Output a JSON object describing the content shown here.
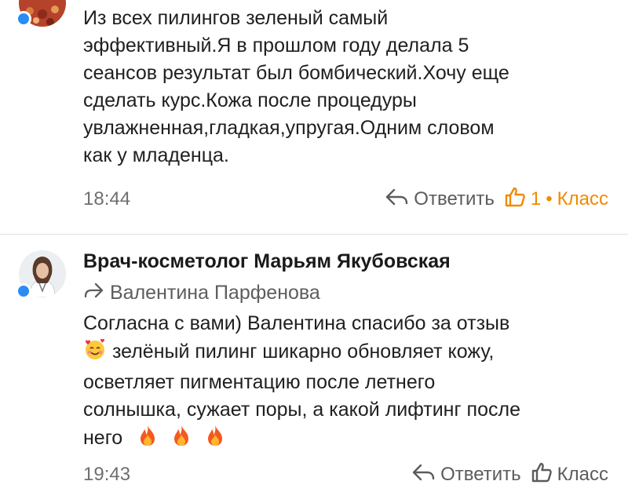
{
  "comments": [
    {
      "text_lines": [
        "Из всех пилингов зеленый самый",
        "эффективный.Я в прошлом году делала 5",
        "сеансов результат был бомбический.Хочу еще",
        "сделать курс.Кожа после процедуры",
        "увлажненная,гладкая,упругая.Одним словом",
        "как у младенца."
      ],
      "time": "18:44",
      "reply_label": "Ответить",
      "like_count": "1",
      "separator": "•",
      "klass_label": "Класс"
    },
    {
      "author": "Врач-косметолог Марьям Якубовская",
      "reply_to": "Валентина Парфенова",
      "text_lines": [
        "Согласна с вами) Валентина спасибо за отзыв",
        "зелёный пилинг шикарно обновляет кожу,",
        "осветляет пигментацию после летнего",
        "солнышка, сужает поры, а какой лифтинг после",
        "него"
      ],
      "time": "19:43",
      "reply_label": "Ответить",
      "klass_label": "Класс"
    }
  ],
  "colors": {
    "accent_orange": "#f08a00",
    "online_blue": "#2b8cf4",
    "meta_gray": "#6f6f6f"
  },
  "icons": [
    "reply-arrow-icon",
    "thumbs-up-icon",
    "forward-arrow-icon",
    "smiling-face-hearts-emoji",
    "fire-emoji"
  ]
}
